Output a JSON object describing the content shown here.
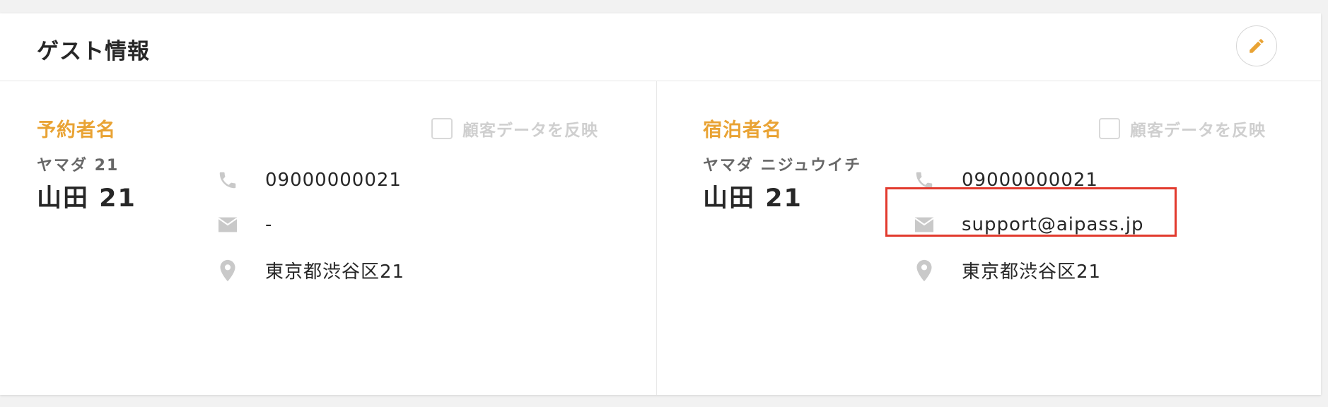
{
  "card": {
    "title": "ゲスト情報",
    "edit_icon": "pencil-icon",
    "accent_color": "#e9a334"
  },
  "reservation": {
    "label": "予約者名",
    "reflect_label": "顧客データを反映",
    "reflect_checked": false,
    "kana": "ヤマダ 21",
    "name": "山田 21",
    "phone": "09000000021",
    "email": "-",
    "address": "東京都渋谷区21"
  },
  "guest": {
    "label": "宿泊者名",
    "reflect_label": "顧客データを反映",
    "reflect_checked": false,
    "kana": "ヤマダ ニジュウイチ",
    "name": "山田 21",
    "phone": "09000000021",
    "email": "support@aipass.jp",
    "address": "東京都渋谷区21"
  },
  "icons": {
    "phone": "phone-icon",
    "email": "mail-icon",
    "address": "location-pin-icon"
  },
  "highlight_color": "#e23a2e"
}
